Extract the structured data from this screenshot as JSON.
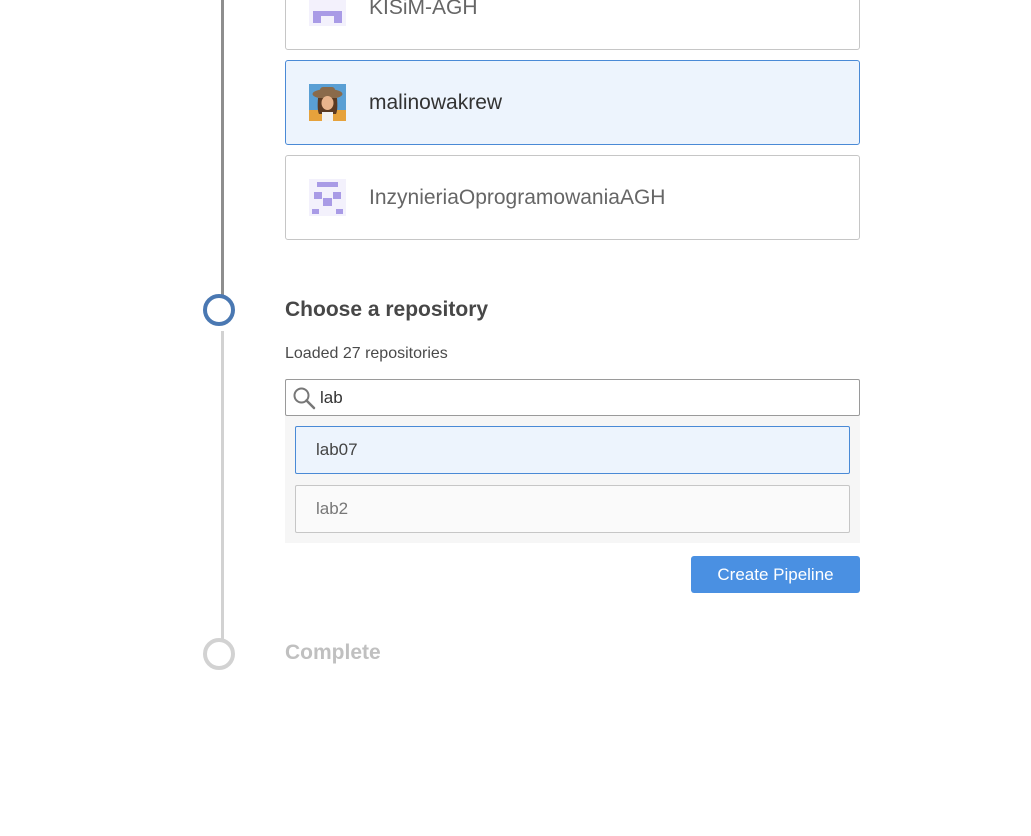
{
  "organizations": [
    {
      "name": "KISiM-AGH",
      "avatar": "kisim-agh-identicon",
      "selected": false
    },
    {
      "name": "malinowakrew",
      "avatar": "malinowakrew-avatar",
      "selected": true
    },
    {
      "name": "InzynieriaOprogramowaniaAGH",
      "avatar": "inzynieria-identicon",
      "selected": false
    }
  ],
  "repo_step": {
    "title": "Choose a repository",
    "status": "Loaded 27 repositories",
    "search_value": "lab",
    "repos": [
      {
        "name": "lab07",
        "selected": true
      },
      {
        "name": "lab2",
        "selected": false
      }
    ],
    "create_button": "Create Pipeline"
  },
  "complete_step": {
    "title": "Complete"
  },
  "colors": {
    "accent": "#4a90e2",
    "active_step": "#4a78b2",
    "selected_bg": "#edf4fd",
    "identicon": "#a99be6"
  }
}
